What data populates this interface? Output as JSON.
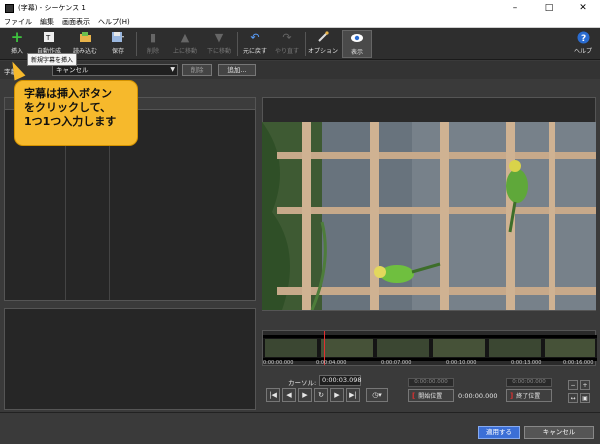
{
  "window": {
    "title": "(字幕) - シーケンス 1"
  },
  "menu": [
    "ファイル",
    "編集",
    "画面表示",
    "ヘルプ(H)"
  ],
  "toolbar": {
    "items": [
      {
        "label": "挿入",
        "icon": "plus-icon",
        "enabled": true
      },
      {
        "label": "自動作成",
        "icon": "auto-text-icon",
        "enabled": true
      },
      {
        "label": "読み込む",
        "icon": "folder-open-icon",
        "enabled": true
      },
      {
        "label": "保存",
        "icon": "save-icon",
        "enabled": true
      },
      {
        "label": "削除",
        "icon": "trash-icon",
        "enabled": false
      },
      {
        "label": "上に移動",
        "icon": "move-up-icon",
        "enabled": false
      },
      {
        "label": "下に移動",
        "icon": "move-down-icon",
        "enabled": false
      },
      {
        "label": "元に戻す",
        "icon": "undo-icon",
        "enabled": true
      },
      {
        "label": "やり直す",
        "icon": "redo-icon",
        "enabled": false
      },
      {
        "label": "オプション",
        "icon": "options-icon",
        "enabled": true
      },
      {
        "label": "表示",
        "icon": "eye-icon",
        "enabled": true
      },
      {
        "label": "ヘルプ",
        "icon": "help-icon",
        "enabled": true
      }
    ],
    "tooltip": "新規字幕を挿入"
  },
  "style_row": {
    "label": "字幕",
    "selected": "キャンセル",
    "delete_label": "削除",
    "add_label": "追加..."
  },
  "callout": {
    "text": "字幕は挿入ボタン\nをクリックして、\n1つ1つ入力します"
  },
  "timeline": {
    "ticks": [
      "0:00:00.000",
      "0:00:04.000",
      "0:00:07.000",
      "0:00:10.000",
      "0:00:13.000",
      "0:00:16.000"
    ]
  },
  "controls": {
    "cursor_label": "カーソル:",
    "cursor_value": "0:00:03.098",
    "start_top": "0:00:00.000",
    "start_label": "開始位置",
    "mid_value": "0:00:00.000",
    "end_top": "0:00:00.000",
    "end_label": "終了位置"
  },
  "footer": {
    "apply_label": "適用する",
    "cancel_label": "キャンセル"
  },
  "colors": {
    "accent": "#3c6fd6",
    "callout": "#f6b92c",
    "plus": "#3ec43e"
  }
}
